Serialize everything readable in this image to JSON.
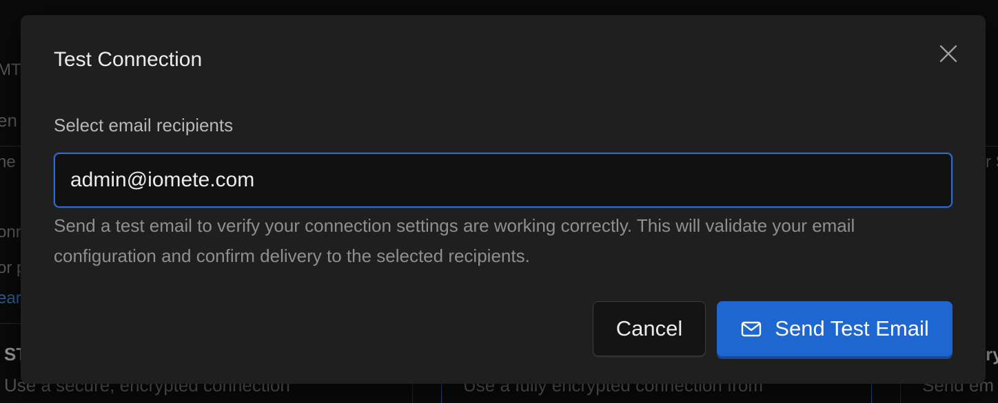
{
  "background": {
    "fragments": [
      "MT",
      "en",
      "he",
      "onn",
      "or p",
      "ear",
      "ST",
      "Use a secure, encrypted connection",
      "Use a fully encrypted connection from",
      "r S",
      "ry",
      "Send em"
    ]
  },
  "dialog": {
    "title": "Test Connection",
    "field_label": "Select email recipients",
    "email_value": "admin@iomete.com",
    "help_text": "Send a test email to verify your connection settings are working correctly. This will validate your email configuration and confirm delivery to the selected recipients.",
    "cancel_label": "Cancel",
    "send_label": "Send Test Email",
    "close_icon": "close-icon",
    "send_icon": "mail-icon"
  },
  "colors": {
    "primary": "#1e66d0",
    "input_border": "#2d6bd0",
    "modal_bg": "#1f1f1f"
  }
}
